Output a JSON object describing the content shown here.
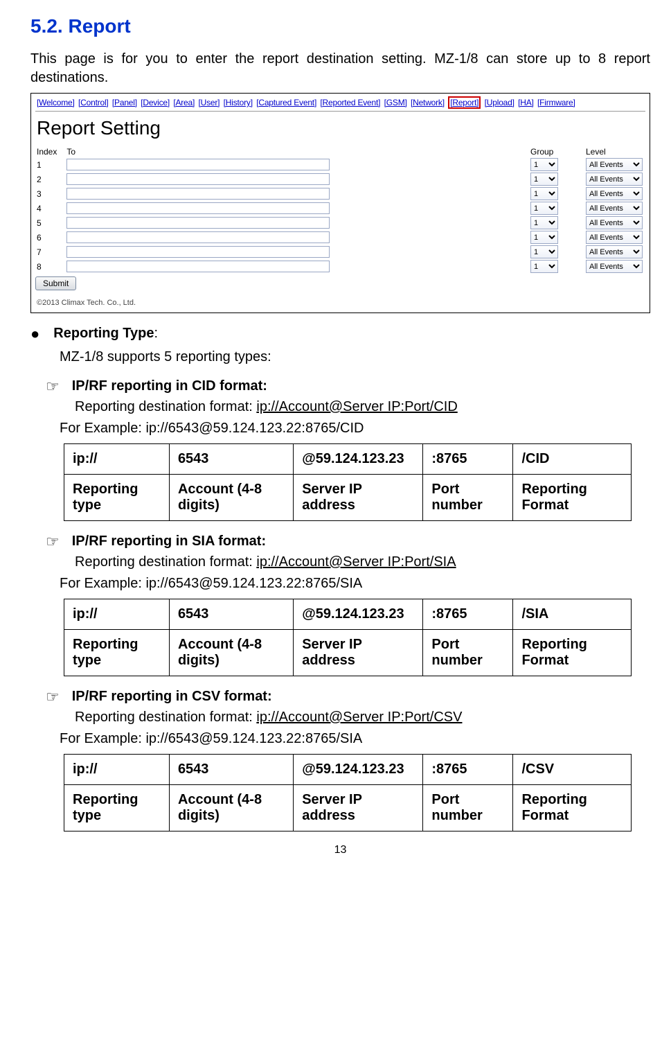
{
  "section": {
    "title": "5.2. Report"
  },
  "intro": "This page is for you to enter the report destination setting. MZ-1/8 can store up to 8 report destinations.",
  "screenshot": {
    "nav": [
      "[Welcome]",
      "[Control]",
      "[Panel]",
      "[Device]",
      "[Area]",
      "[User]",
      "[History]",
      "[Captured Event]",
      "[Reported Event]",
      "[GSM]",
      "[Network]",
      "[Report]",
      "[Upload]",
      "[HA]",
      "[Firmware]"
    ],
    "highlight_index": 11,
    "page_title": "Report Setting",
    "table": {
      "headers": [
        "Index",
        "To",
        "Group",
        "Level"
      ],
      "row_count": 8,
      "group_default": "1",
      "level_default": "All Events"
    },
    "submit": "Submit",
    "copyright": "©2013 Climax Tech. Co., Ltd."
  },
  "reporting_type": {
    "label": "Reporting Type",
    "colon": ":",
    "text": "MZ-1/8 supports 5 reporting types:"
  },
  "hand_label": "☞",
  "bullet_label": "●",
  "formats": [
    {
      "title": "IP/RF reporting in CID format:",
      "dest_prefix": "Reporting destination format: ",
      "dest_underline": "ip://Account@Server IP:Port/CID",
      "example": "For Example: ip://6543@59.124.123.22:8765/CID",
      "row1": [
        "ip://",
        "6543",
        "@59.124.123.23",
        ":8765",
        "/CID"
      ],
      "row2": [
        "Reporting type",
        "Account (4-8 digits)",
        "Server IP address",
        "Port number",
        "Reporting Format"
      ]
    },
    {
      "title": "IP/RF reporting in SIA format:",
      "dest_prefix": "Reporting destination format: ",
      "dest_underline": "ip://Account@Server IP:Port/SIA",
      "example": "For Example: ip://6543@59.124.123.22:8765/SIA",
      "row1": [
        "ip://",
        "6543",
        "@59.124.123.23",
        ":8765",
        "/SIA"
      ],
      "row2": [
        "Reporting type",
        "Account (4-8 digits)",
        "Server IP address",
        "Port number",
        "Reporting Format"
      ]
    },
    {
      "title": "IP/RF reporting in CSV format:",
      "dest_prefix": "Reporting destination format: ",
      "dest_underline": "ip://Account@Server IP:Port/CSV",
      "example": "For Example: ip://6543@59.124.123.22:8765/SIA",
      "row1": [
        "ip://",
        "6543",
        "@59.124.123.23",
        ":8765",
        "/CSV"
      ],
      "row2": [
        "Reporting type",
        "Account (4-8 digits)",
        "Server IP address",
        "Port number",
        "Reporting Format"
      ]
    }
  ],
  "page_number": "13"
}
